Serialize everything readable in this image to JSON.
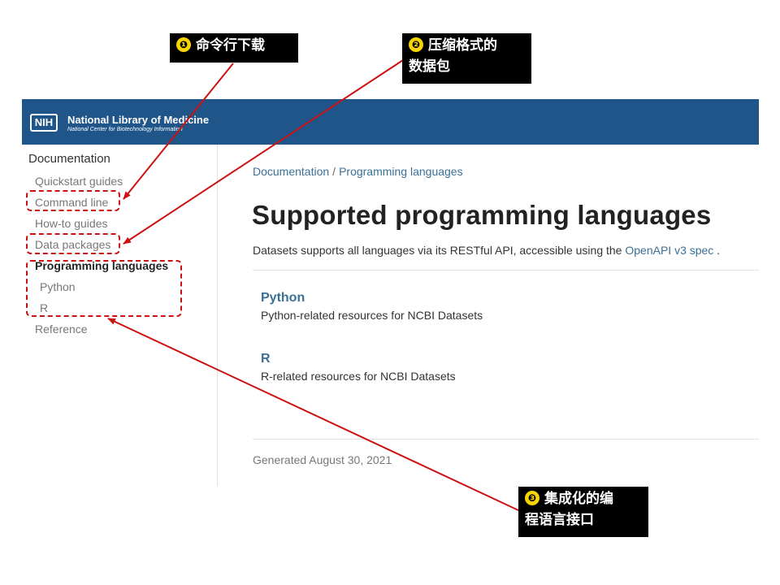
{
  "header": {
    "logo_text": "NIH",
    "org_name": "National Library of Medicine",
    "org_sub": "National Center for Biotechnology Information"
  },
  "sidebar": {
    "root": "Documentation",
    "items": [
      {
        "label": "Quickstart guides"
      },
      {
        "label": "Command line"
      },
      {
        "label": "How-to guides"
      },
      {
        "label": "Data packages"
      },
      {
        "label": "Programming languages"
      },
      {
        "label": "Python"
      },
      {
        "label": "R"
      },
      {
        "label": "Reference"
      }
    ]
  },
  "breadcrumb": {
    "items": [
      "Documentation",
      "Programming languages"
    ],
    "separator": "/"
  },
  "main": {
    "title": "Supported programming languages",
    "description_prefix": "Datasets supports all languages via its RESTful API, accessible using the",
    "description_link": "OpenAPI v3 spec",
    "description_suffix": ".",
    "cards": [
      {
        "title": "Python",
        "description": "Python-related resources for NCBI Datasets"
      },
      {
        "title": "R",
        "description": "R-related resources for NCBI Datasets"
      }
    ],
    "footer": "Generated August 30, 2021"
  },
  "annotations": {
    "callouts": [
      {
        "number": "❶",
        "lines": [
          "命令行下载"
        ]
      },
      {
        "number": "❷",
        "lines": [
          "压缩格式的",
          "数据包"
        ]
      },
      {
        "number": "❸",
        "lines": [
          "集成化的编",
          "程语言接口"
        ]
      }
    ],
    "color": "#cc1111",
    "number_color": "#f5d400"
  },
  "colors": {
    "header_bg": "#20558a",
    "link": "#3a6f97",
    "text": "#333333",
    "muted": "#777777"
  }
}
